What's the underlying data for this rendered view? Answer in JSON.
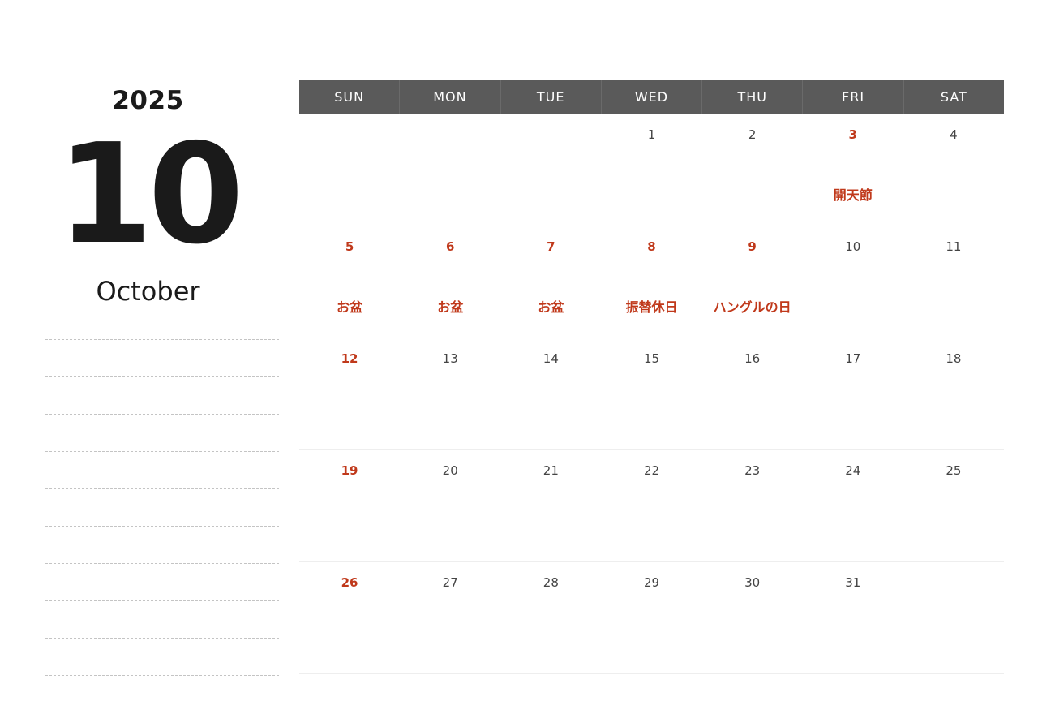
{
  "year": "2025",
  "month_number": "10",
  "month_name": "October",
  "colors": {
    "header_bg": "#5a5a5a",
    "holiday": "#c0391b",
    "text": "#444444"
  },
  "weekdays": [
    "SUN",
    "MON",
    "TUE",
    "WED",
    "THU",
    "FRI",
    "SAT"
  ],
  "weeks": [
    [
      {
        "day": "",
        "holiday": false,
        "label": ""
      },
      {
        "day": "",
        "holiday": false,
        "label": ""
      },
      {
        "day": "",
        "holiday": false,
        "label": ""
      },
      {
        "day": "1",
        "holiday": false,
        "label": ""
      },
      {
        "day": "2",
        "holiday": false,
        "label": ""
      },
      {
        "day": "3",
        "holiday": true,
        "label": "開天節"
      },
      {
        "day": "4",
        "holiday": false,
        "label": ""
      }
    ],
    [
      {
        "day": "5",
        "holiday": true,
        "label": "お盆"
      },
      {
        "day": "6",
        "holiday": true,
        "label": "お盆"
      },
      {
        "day": "7",
        "holiday": true,
        "label": "お盆"
      },
      {
        "day": "8",
        "holiday": true,
        "label": "振替休日"
      },
      {
        "day": "9",
        "holiday": true,
        "label": "ハングルの日"
      },
      {
        "day": "10",
        "holiday": false,
        "label": ""
      },
      {
        "day": "11",
        "holiday": false,
        "label": ""
      }
    ],
    [
      {
        "day": "12",
        "holiday": true,
        "label": ""
      },
      {
        "day": "13",
        "holiday": false,
        "label": ""
      },
      {
        "day": "14",
        "holiday": false,
        "label": ""
      },
      {
        "day": "15",
        "holiday": false,
        "label": ""
      },
      {
        "day": "16",
        "holiday": false,
        "label": ""
      },
      {
        "day": "17",
        "holiday": false,
        "label": ""
      },
      {
        "day": "18",
        "holiday": false,
        "label": ""
      }
    ],
    [
      {
        "day": "19",
        "holiday": true,
        "label": ""
      },
      {
        "day": "20",
        "holiday": false,
        "label": ""
      },
      {
        "day": "21",
        "holiday": false,
        "label": ""
      },
      {
        "day": "22",
        "holiday": false,
        "label": ""
      },
      {
        "day": "23",
        "holiday": false,
        "label": ""
      },
      {
        "day": "24",
        "holiday": false,
        "label": ""
      },
      {
        "day": "25",
        "holiday": false,
        "label": ""
      }
    ],
    [
      {
        "day": "26",
        "holiday": true,
        "label": ""
      },
      {
        "day": "27",
        "holiday": false,
        "label": ""
      },
      {
        "day": "28",
        "holiday": false,
        "label": ""
      },
      {
        "day": "29",
        "holiday": false,
        "label": ""
      },
      {
        "day": "30",
        "holiday": false,
        "label": ""
      },
      {
        "day": "31",
        "holiday": false,
        "label": ""
      },
      {
        "day": "",
        "holiday": false,
        "label": ""
      }
    ]
  ]
}
